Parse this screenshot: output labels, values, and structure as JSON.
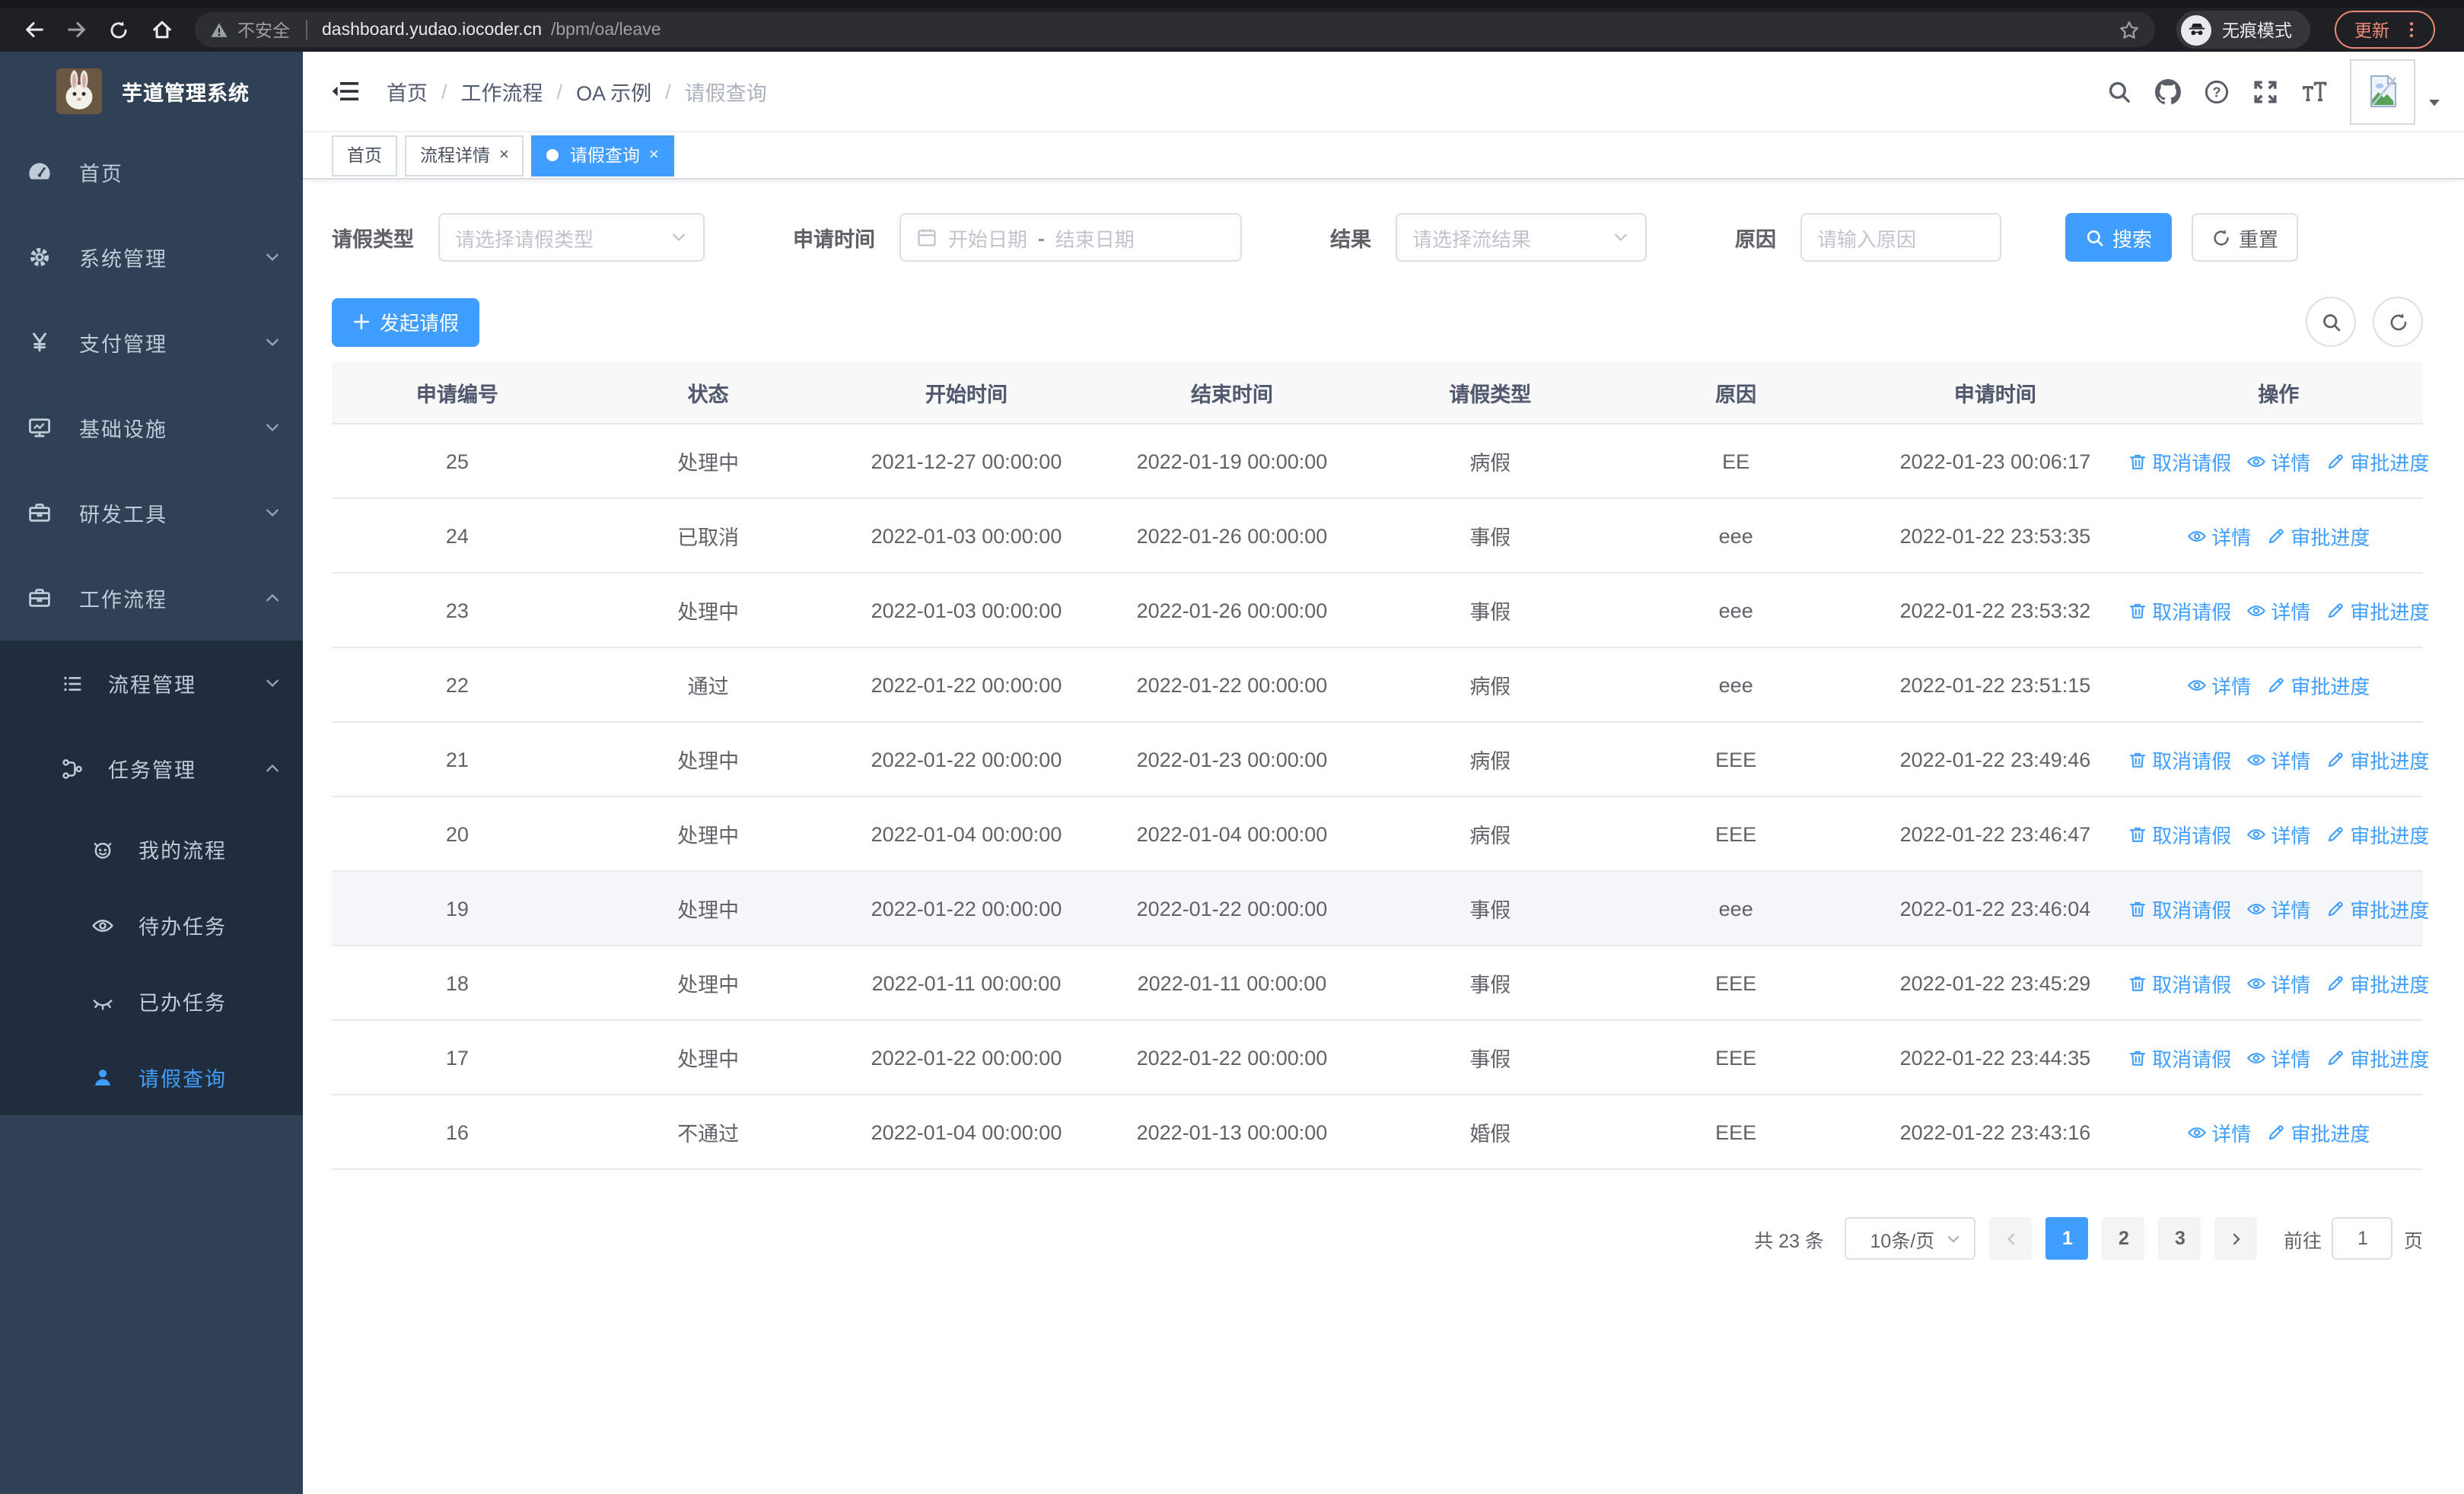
{
  "browser": {
    "security_warning": "不安全",
    "url_host": "dashboard.yudao.iocoder.cn",
    "url_path": "/bpm/oa/leave",
    "incognito_label": "无痕模式",
    "update_label": "更新"
  },
  "sidebar": {
    "app_title": "芋道管理系统",
    "items": [
      {
        "label": "首页",
        "icon": "dashboard-icon",
        "chevron": "none",
        "active": false
      },
      {
        "label": "系统管理",
        "icon": "gear-icon",
        "chevron": "down",
        "active": false
      },
      {
        "label": "支付管理",
        "icon": "yen-icon",
        "chevron": "down",
        "active": false
      },
      {
        "label": "基础设施",
        "icon": "monitor-icon",
        "chevron": "down",
        "active": false
      },
      {
        "label": "研发工具",
        "icon": "briefcase-icon",
        "chevron": "down",
        "active": false
      },
      {
        "label": "工作流程",
        "icon": "briefcase-icon",
        "chevron": "up",
        "active": false
      }
    ],
    "submenu": [
      {
        "label": "流程管理",
        "icon": "list-icon",
        "level": 1,
        "chevron": "down",
        "active": false
      },
      {
        "label": "任务管理",
        "icon": "flow-icon",
        "level": 1,
        "chevron": "up",
        "active": false
      },
      {
        "label": "我的流程",
        "icon": "robot-icon",
        "level": 2,
        "chevron": "none",
        "active": false
      },
      {
        "label": "待办任务",
        "icon": "eye-icon",
        "level": 2,
        "chevron": "none",
        "active": false
      },
      {
        "label": "已办任务",
        "icon": "eye-closed-icon",
        "level": 2,
        "chevron": "none",
        "active": false
      },
      {
        "label": "请假查询",
        "icon": "user-icon",
        "level": 2,
        "chevron": "none",
        "active": true
      }
    ]
  },
  "navbar": {
    "breadcrumb": [
      "首页",
      "工作流程",
      "OA 示例",
      "请假查询"
    ]
  },
  "tags": [
    {
      "label": "首页",
      "closable": false,
      "active": false
    },
    {
      "label": "流程详情",
      "closable": true,
      "active": false
    },
    {
      "label": "请假查询",
      "closable": true,
      "active": true
    }
  ],
  "filters": {
    "leave_type_label": "请假类型",
    "leave_type_placeholder": "请选择请假类型",
    "apply_time_label": "申请时间",
    "date_start_placeholder": "开始日期",
    "date_separator": "-",
    "date_end_placeholder": "结束日期",
    "result_label": "结果",
    "result_placeholder": "请选择流结果",
    "reason_label": "原因",
    "reason_placeholder": "请输入原因",
    "search_label": "搜索",
    "reset_label": "重置"
  },
  "toolbar": {
    "create_label": "发起请假"
  },
  "table": {
    "headers": [
      "申请编号",
      "状态",
      "开始时间",
      "结束时间",
      "请假类型",
      "原因",
      "申请时间",
      "操作"
    ],
    "action_labels": {
      "cancel": "取消请假",
      "detail": "详情",
      "progress": "审批进度"
    },
    "rows": [
      {
        "id": "25",
        "status": "处理中",
        "start": "2021-12-27 00:00:00",
        "end": "2022-01-19 00:00:00",
        "type": "病假",
        "reason": "EE",
        "applied": "2022-01-23 00:06:17",
        "actions": [
          "cancel",
          "detail",
          "progress"
        ],
        "highlight": false
      },
      {
        "id": "24",
        "status": "已取消",
        "start": "2022-01-03 00:00:00",
        "end": "2022-01-26 00:00:00",
        "type": "事假",
        "reason": "eee",
        "applied": "2022-01-22 23:53:35",
        "actions": [
          "detail",
          "progress"
        ],
        "highlight": false
      },
      {
        "id": "23",
        "status": "处理中",
        "start": "2022-01-03 00:00:00",
        "end": "2022-01-26 00:00:00",
        "type": "事假",
        "reason": "eee",
        "applied": "2022-01-22 23:53:32",
        "actions": [
          "cancel",
          "detail",
          "progress"
        ],
        "highlight": false
      },
      {
        "id": "22",
        "status": "通过",
        "start": "2022-01-22 00:00:00",
        "end": "2022-01-22 00:00:00",
        "type": "病假",
        "reason": "eee",
        "applied": "2022-01-22 23:51:15",
        "actions": [
          "detail",
          "progress"
        ],
        "highlight": false
      },
      {
        "id": "21",
        "status": "处理中",
        "start": "2022-01-22 00:00:00",
        "end": "2022-01-23 00:00:00",
        "type": "病假",
        "reason": "EEE",
        "applied": "2022-01-22 23:49:46",
        "actions": [
          "cancel",
          "detail",
          "progress"
        ],
        "highlight": false
      },
      {
        "id": "20",
        "status": "处理中",
        "start": "2022-01-04 00:00:00",
        "end": "2022-01-04 00:00:00",
        "type": "病假",
        "reason": "EEE",
        "applied": "2022-01-22 23:46:47",
        "actions": [
          "cancel",
          "detail",
          "progress"
        ],
        "highlight": false
      },
      {
        "id": "19",
        "status": "处理中",
        "start": "2022-01-22 00:00:00",
        "end": "2022-01-22 00:00:00",
        "type": "事假",
        "reason": "eee",
        "applied": "2022-01-22 23:46:04",
        "actions": [
          "cancel",
          "detail",
          "progress"
        ],
        "highlight": true
      },
      {
        "id": "18",
        "status": "处理中",
        "start": "2022-01-11 00:00:00",
        "end": "2022-01-11 00:00:00",
        "type": "事假",
        "reason": "EEE",
        "applied": "2022-01-22 23:45:29",
        "actions": [
          "cancel",
          "detail",
          "progress"
        ],
        "highlight": false
      },
      {
        "id": "17",
        "status": "处理中",
        "start": "2022-01-22 00:00:00",
        "end": "2022-01-22 00:00:00",
        "type": "事假",
        "reason": "EEE",
        "applied": "2022-01-22 23:44:35",
        "actions": [
          "cancel",
          "detail",
          "progress"
        ],
        "highlight": false
      },
      {
        "id": "16",
        "status": "不通过",
        "start": "2022-01-04 00:00:00",
        "end": "2022-01-13 00:00:00",
        "type": "婚假",
        "reason": "EEE",
        "applied": "2022-01-22 23:43:16",
        "actions": [
          "detail",
          "progress"
        ],
        "highlight": false
      }
    ]
  },
  "pagination": {
    "total": "共 23 条",
    "page_size": "10条/页",
    "pages": [
      "1",
      "2",
      "3"
    ],
    "active_page": "1",
    "goto_label": "前往",
    "goto_value": "1",
    "goto_suffix": "页"
  },
  "colors": {
    "accent": "#409eff",
    "sidebar_bg": "#304156",
    "submenu_bg": "#1f2d3d",
    "update_red": "#f08b79",
    "table_header_bg": "#f8f8f9"
  }
}
